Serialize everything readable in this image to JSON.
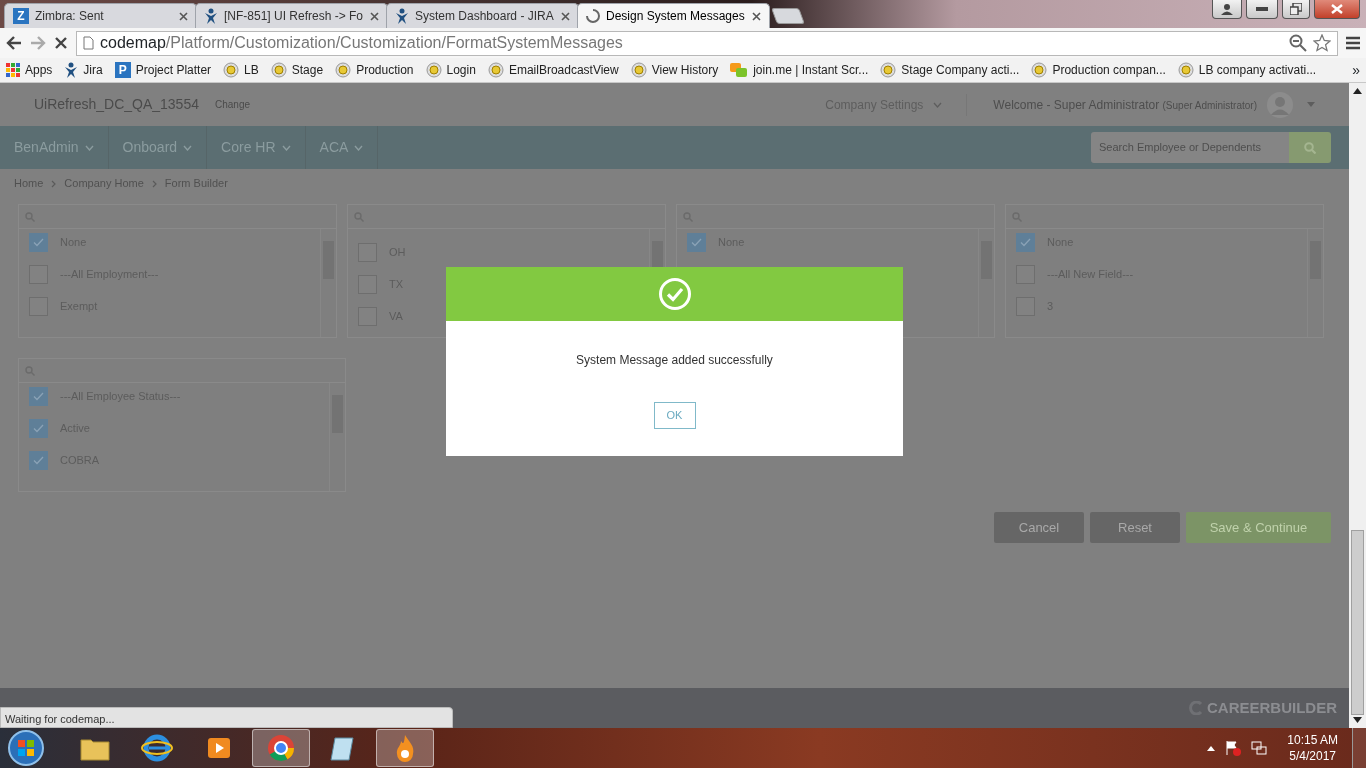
{
  "browser": {
    "tabs": [
      {
        "title": "Zimbra: Sent",
        "selected": false,
        "kind": "letter",
        "icon_text": "Z"
      },
      {
        "title": "[NF-851] UI Refresh -> Fo",
        "selected": false,
        "kind": "jira"
      },
      {
        "title": "System Dashboard - JIRA",
        "selected": false,
        "kind": "jira"
      },
      {
        "title": "Design System Messages",
        "selected": true,
        "kind": "loading"
      }
    ],
    "address": {
      "host": "codemap",
      "path": "/Platform/Customization/Customization/FormatSystemMessages"
    },
    "bookmarks": [
      {
        "label": "Apps",
        "kind": "apps"
      },
      {
        "label": "Jira",
        "kind": "jira"
      },
      {
        "label": "Project Platter",
        "kind": "letter",
        "icon_text": "P"
      },
      {
        "label": "LB",
        "kind": "site"
      },
      {
        "label": "Stage",
        "kind": "site"
      },
      {
        "label": "Production",
        "kind": "site"
      },
      {
        "label": "Login",
        "kind": "site"
      },
      {
        "label": "EmailBroadcastView",
        "kind": "site"
      },
      {
        "label": "View History",
        "kind": "site"
      },
      {
        "label": "join.me | Instant Scr...",
        "kind": "joinme"
      },
      {
        "label": "Stage Company acti...",
        "kind": "site"
      },
      {
        "label": "Production compan...",
        "kind": "site"
      },
      {
        "label": "LB company activati...",
        "kind": "site"
      }
    ],
    "bookmarks_overflow": "»",
    "status": "Waiting for codemap..."
  },
  "header": {
    "company": "UiRefresh_DC_QA_13554",
    "change": "Change",
    "settings": "Company Settings",
    "welcome": "Welcome -",
    "user": "Super Administrator",
    "role": "(Super Administrator)"
  },
  "nav": [
    {
      "label": "BenAdmin"
    },
    {
      "label": "Onboard"
    },
    {
      "label": "Core HR"
    },
    {
      "label": "ACA"
    }
  ],
  "search": {
    "placeholder": "Search Employee or Dependents"
  },
  "breadcrumbs": [
    "Home",
    "Company Home",
    "Form Builder"
  ],
  "filters": [
    {
      "items": [
        {
          "label": "None",
          "checked": true
        },
        {
          "label": "---All Employment---",
          "checked": false
        },
        {
          "label": "Exempt",
          "checked": false
        }
      ]
    },
    {
      "items": [
        {
          "label": "OH",
          "checked": false
        },
        {
          "label": "TX",
          "checked": false
        },
        {
          "label": "VA",
          "checked": false
        }
      ]
    },
    {
      "items": [
        {
          "label": "None",
          "checked": true
        }
      ]
    },
    {
      "items": [
        {
          "label": "None",
          "checked": true
        },
        {
          "label": "---All New Field---",
          "checked": false
        },
        {
          "label": "3",
          "checked": false
        }
      ]
    },
    {
      "items": [
        {
          "label": "---All Employee Status---",
          "checked": true
        },
        {
          "label": "Active",
          "checked": true
        },
        {
          "label": "COBRA",
          "checked": true
        }
      ]
    }
  ],
  "buttons": [
    {
      "label": "Cancel",
      "kind": "secondary"
    },
    {
      "label": "Reset",
      "kind": "secondary"
    },
    {
      "label": "Save & Continue",
      "kind": "primary"
    }
  ],
  "footer": {
    "logo": "CAREERBUILDER"
  },
  "modal": {
    "message": "System Message added successfully",
    "button": "OK"
  },
  "taskbar": {
    "apps": [
      {
        "kind": "folder",
        "selected": false
      },
      {
        "kind": "browser-e",
        "selected": false
      },
      {
        "kind": "media",
        "selected": false
      },
      {
        "kind": "chrome",
        "selected": true
      },
      {
        "kind": "notepad",
        "selected": false
      },
      {
        "kind": "flame",
        "selected": true
      }
    ],
    "time": "10:15 AM",
    "date": "5/4/2017"
  }
}
